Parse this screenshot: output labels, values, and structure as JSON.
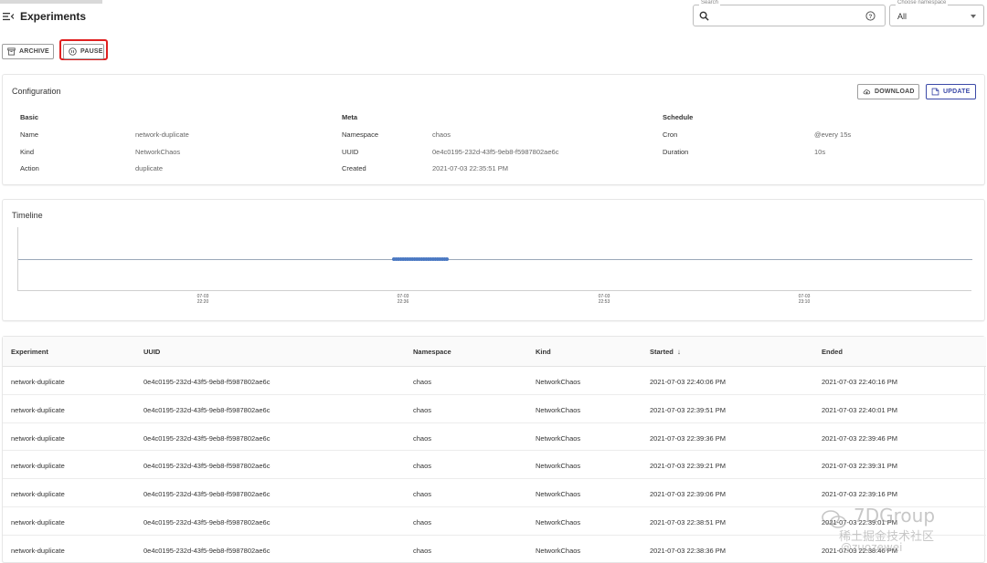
{
  "header": {
    "title": "Experiments",
    "search": {
      "legend": "Search",
      "value": ""
    },
    "namespace": {
      "legend": "Choose namespace",
      "value": "All"
    }
  },
  "actions": {
    "archive": "ARCHIVE",
    "pause": "PAUSE"
  },
  "configuration": {
    "title": "Configuration",
    "download": "DOWNLOAD",
    "update": "UPDATE",
    "basic": {
      "heading": "Basic",
      "rows": [
        {
          "label": "Name",
          "value": "network-duplicate"
        },
        {
          "label": "Kind",
          "value": "NetworkChaos"
        },
        {
          "label": "Action",
          "value": "duplicate"
        }
      ]
    },
    "meta": {
      "heading": "Meta",
      "rows": [
        {
          "label": "Namespace",
          "value": "chaos"
        },
        {
          "label": "UUID",
          "value": "0e4c0195-232d-43f5-9eb8-f5987802ae6c"
        },
        {
          "label": "Created",
          "value": "2021-07-03 22:35:51 PM"
        }
      ]
    },
    "schedule": {
      "heading": "Schedule",
      "rows": [
        {
          "label": "Cron",
          "value": "@every 15s"
        },
        {
          "label": "Duration",
          "value": "10s"
        }
      ]
    }
  },
  "timeline": {
    "title": "Timeline",
    "ticks": [
      {
        "date": "07-03",
        "time": "22:20"
      },
      {
        "date": "07-03",
        "time": "22:36"
      },
      {
        "date": "07-03",
        "time": "22:53"
      },
      {
        "date": "07-03",
        "time": "23:10"
      }
    ],
    "colors": {
      "line": "#9aa8b8",
      "event": "#4a78c2"
    }
  },
  "table": {
    "columns": {
      "experiment": "Experiment",
      "uuid": "UUID",
      "namespace": "Namespace",
      "kind": "Kind",
      "started": "Started",
      "ended": "Ended"
    },
    "rows": [
      {
        "experiment": "network-duplicate",
        "uuid": "0e4c0195-232d-43f5-9eb8-f5987802ae6c",
        "namespace": "chaos",
        "kind": "NetworkChaos",
        "started": "2021-07-03 22:40:06 PM",
        "ended": "2021-07-03 22:40:16 PM"
      },
      {
        "experiment": "network-duplicate",
        "uuid": "0e4c0195-232d-43f5-9eb8-f5987802ae6c",
        "namespace": "chaos",
        "kind": "NetworkChaos",
        "started": "2021-07-03 22:39:51 PM",
        "ended": "2021-07-03 22:40:01 PM"
      },
      {
        "experiment": "network-duplicate",
        "uuid": "0e4c0195-232d-43f5-9eb8-f5987802ae6c",
        "namespace": "chaos",
        "kind": "NetworkChaos",
        "started": "2021-07-03 22:39:36 PM",
        "ended": "2021-07-03 22:39:46 PM"
      },
      {
        "experiment": "network-duplicate",
        "uuid": "0e4c0195-232d-43f5-9eb8-f5987802ae6c",
        "namespace": "chaos",
        "kind": "NetworkChaos",
        "started": "2021-07-03 22:39:21 PM",
        "ended": "2021-07-03 22:39:31 PM"
      },
      {
        "experiment": "network-duplicate",
        "uuid": "0e4c0195-232d-43f5-9eb8-f5987802ae6c",
        "namespace": "chaos",
        "kind": "NetworkChaos",
        "started": "2021-07-03 22:39:06 PM",
        "ended": "2021-07-03 22:39:16 PM"
      },
      {
        "experiment": "network-duplicate",
        "uuid": "0e4c0195-232d-43f5-9eb8-f5987802ae6c",
        "namespace": "chaos",
        "kind": "NetworkChaos",
        "started": "2021-07-03 22:38:51 PM",
        "ended": "2021-07-03 22:39:01 PM"
      },
      {
        "experiment": "network-duplicate",
        "uuid": "0e4c0195-232d-43f5-9eb8-f5987802ae6c",
        "namespace": "chaos",
        "kind": "NetworkChaos",
        "started": "2021-07-03 22:38:36 PM",
        "ended": "2021-07-03 22:38:46 PM"
      }
    ]
  },
  "watermark": {
    "brand": "7DGroup",
    "line1": "稀土掘金技术社区",
    "line2": "@zuozewei"
  },
  "colors": {
    "pause_highlight": "#e02020",
    "update_accent": "#3c4aa8"
  }
}
